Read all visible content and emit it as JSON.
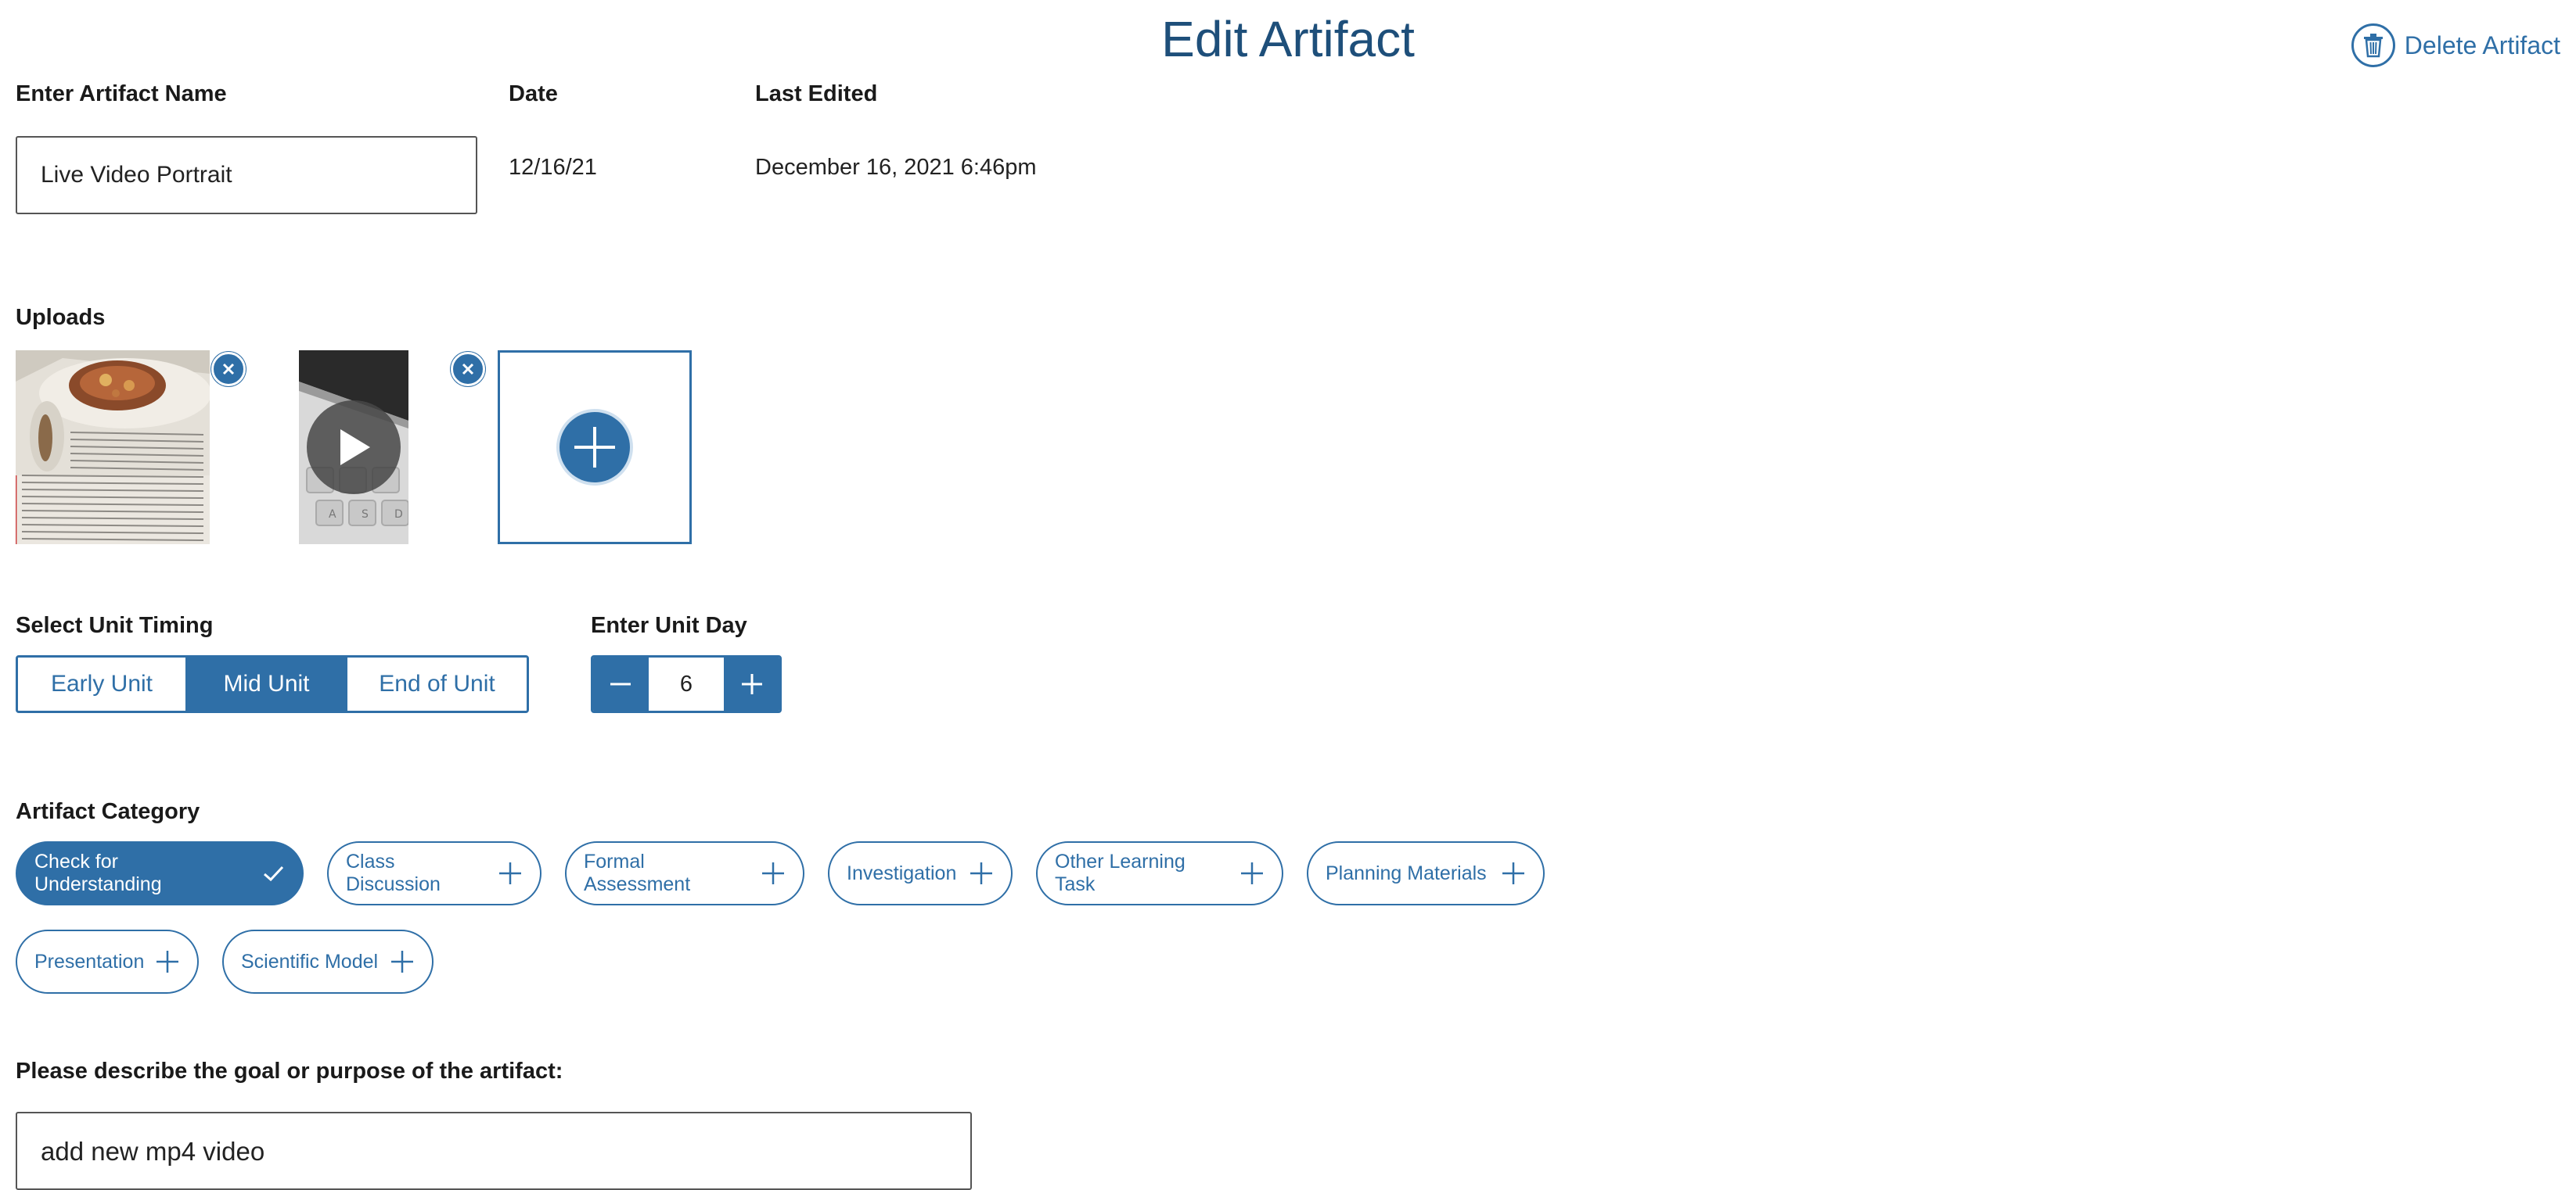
{
  "page": {
    "title": "Edit Artifact"
  },
  "header": {
    "delete_label": "Delete Artifact"
  },
  "fields": {
    "name_label": "Enter Artifact Name",
    "name_value": "Live Video Portrait",
    "date_label": "Date",
    "date_value": "12/16/21",
    "last_edited_label": "Last Edited",
    "last_edited_value": "December 16, 2021 6:46pm"
  },
  "uploads": {
    "label": "Uploads"
  },
  "unit_timing": {
    "label": "Select Unit Timing",
    "options": [
      "Early Unit",
      "Mid Unit",
      "End of Unit"
    ],
    "selected": "Mid Unit"
  },
  "unit_day": {
    "label": "Enter Unit Day",
    "value": "6"
  },
  "category": {
    "label": "Artifact Category",
    "options": [
      {
        "label": "Check for Understanding",
        "selected": true
      },
      {
        "label": "Class Discussion",
        "selected": false
      },
      {
        "label": "Formal Assessment",
        "selected": false
      },
      {
        "label": "Investigation",
        "selected": false
      },
      {
        "label": "Other Learning Task",
        "selected": false
      },
      {
        "label": "Planning Materials",
        "selected": false
      },
      {
        "label": "Presentation",
        "selected": false
      },
      {
        "label": "Scientific Model",
        "selected": false
      }
    ]
  },
  "goal": {
    "label": "Please describe the goal or purpose of the artifact:",
    "value": "add new mp4 video"
  },
  "colors": {
    "accent": "#2f6fa7",
    "title": "#1e4f7a"
  }
}
